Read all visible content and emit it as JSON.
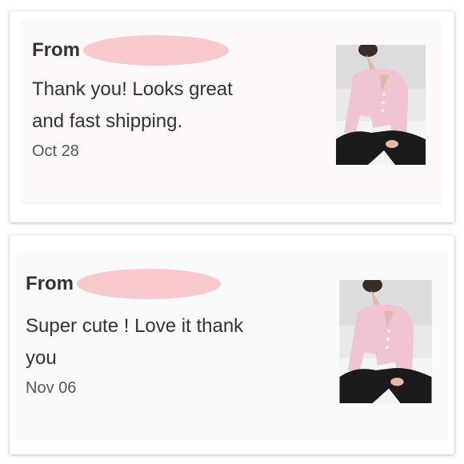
{
  "colors": {
    "redaction": "#f7c8cc",
    "sweater": "#f0c4d2",
    "pants": "#1b1b1d"
  },
  "reviews": [
    {
      "from_label": "From",
      "text_line1": "Thank you! Looks great",
      "text_line2": "and fast shipping.",
      "date": "Oct 28",
      "thumbnail": "product-photo-pink-sweater"
    },
    {
      "from_label": "From",
      "text_line1": "Super cute ! Love it thank",
      "text_line2": "you",
      "date": "Nov 06",
      "thumbnail": "product-photo-pink-sweater"
    }
  ]
}
